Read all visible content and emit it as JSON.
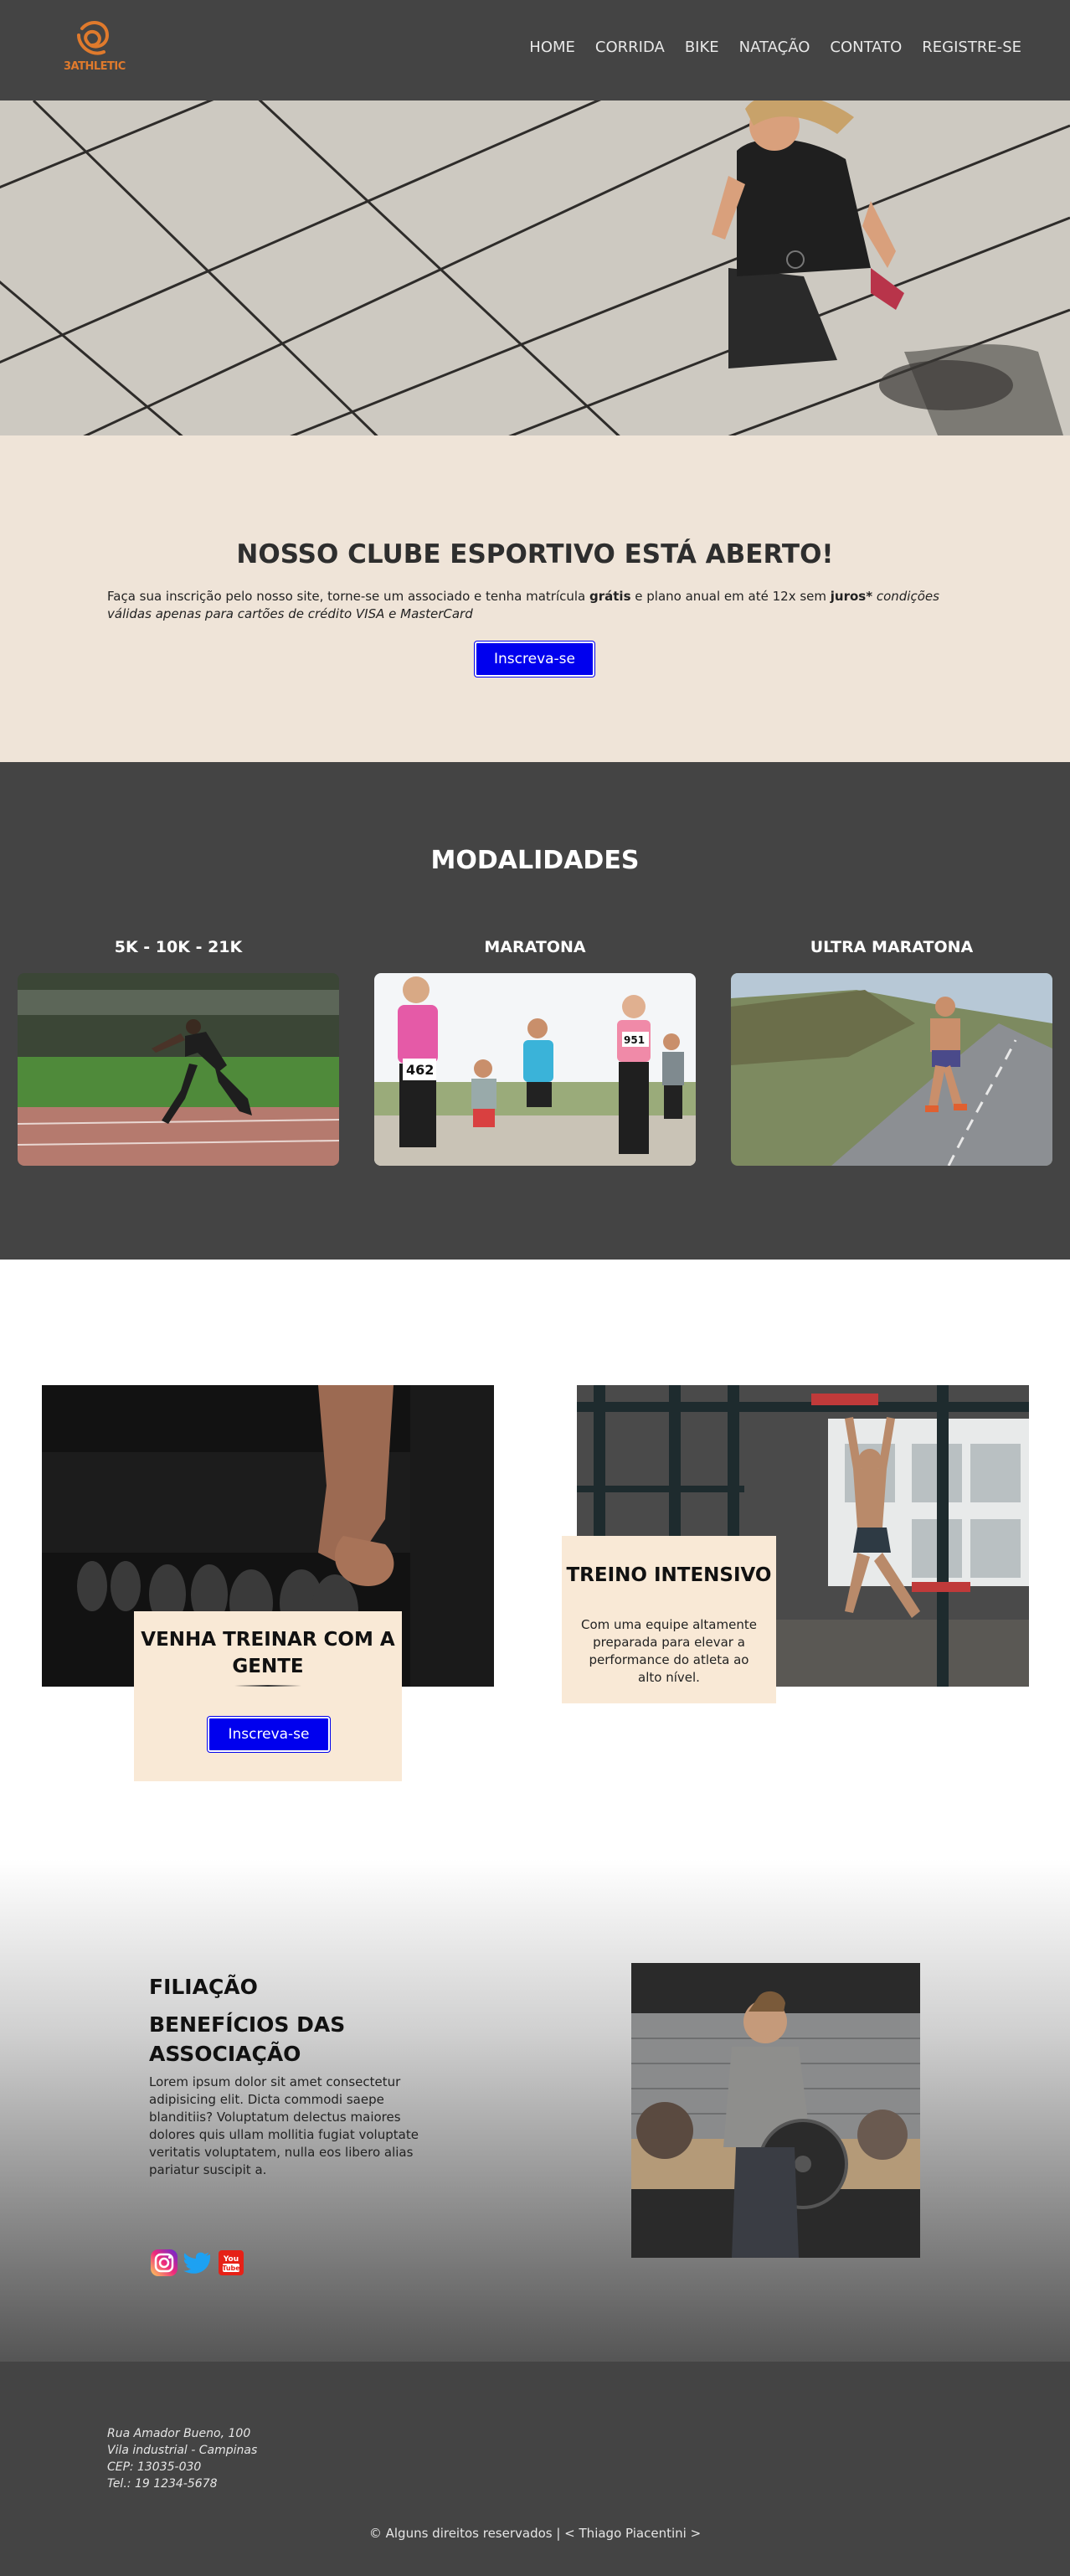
{
  "brand": {
    "logo_text": "3ATHLETIC",
    "accent": "#e07a2c"
  },
  "nav": {
    "items": [
      "HOME",
      "CORRIDA",
      "BIKE",
      "NATAÇÃO",
      "CONTATO",
      "REGISTRE-SE"
    ]
  },
  "colors": {
    "dark_bg": "#444444",
    "cream_bg": "#efe4d8",
    "card_bg": "#f9e9d6",
    "button_blue": "#0000ee"
  },
  "club": {
    "title": "NOSSO CLUBE ESPORTIVO ESTÁ ABERTO!",
    "text_1": "Faça sua inscrição pelo nosso site, torne-se um associado e tenha matrícula ",
    "bold_1": "grátis",
    "text_2": " e plano anual em até 12x sem ",
    "bold_2": "juros*",
    "italic": " condições válidas apenas para cartões de crédito VISA e MasterCard",
    "button": "Inscreva-se"
  },
  "modalidades": {
    "title": "MODALIDADES",
    "cards": [
      {
        "label": "5K - 10K - 21K",
        "image": "sprinter-on-track"
      },
      {
        "label": "MARATONA",
        "image": "marathon-runners-group"
      },
      {
        "label": "ULTRA MARATONA",
        "image": "runner-on-road"
      }
    ]
  },
  "train": {
    "card_1": {
      "title": "VENHA TREINAR COM A GENTE",
      "button": "Inscreva-se",
      "image": "hand-grabbing-dumbbell"
    },
    "card_2": {
      "title": "TREINO INTENSIVO",
      "text": "Com uma equipe altamente preparada para elevar a performance do atleta ao alto nível.",
      "image": "athlete-jumping-gym"
    }
  },
  "filiacao": {
    "title": "FILIAÇÃO",
    "subtitle": "BENEFÍCIOS DAS ASSOCIAÇÃO",
    "text": "Lorem ipsum dolor sit amet consectetur adipisicing elit. Dicta commodi saepe blanditiis? Voluptatum delectus maiores dolores quis ullam mollitia fugiat voluptate veritatis voluptatem, nulla eos libero alias pariatur suscipit a.",
    "image": "man-holding-weight-plate",
    "social": [
      "instagram-icon",
      "twitter-icon",
      "youtube-icon"
    ]
  },
  "footer": {
    "address": [
      "Rua Amador Bueno, 100",
      "Vila industrial - Campinas",
      "CEP: 13035-030",
      "Tel.: 19 1234-5678"
    ],
    "copyright": "© Alguns direitos reservados | < Thiago Piacentini >"
  }
}
